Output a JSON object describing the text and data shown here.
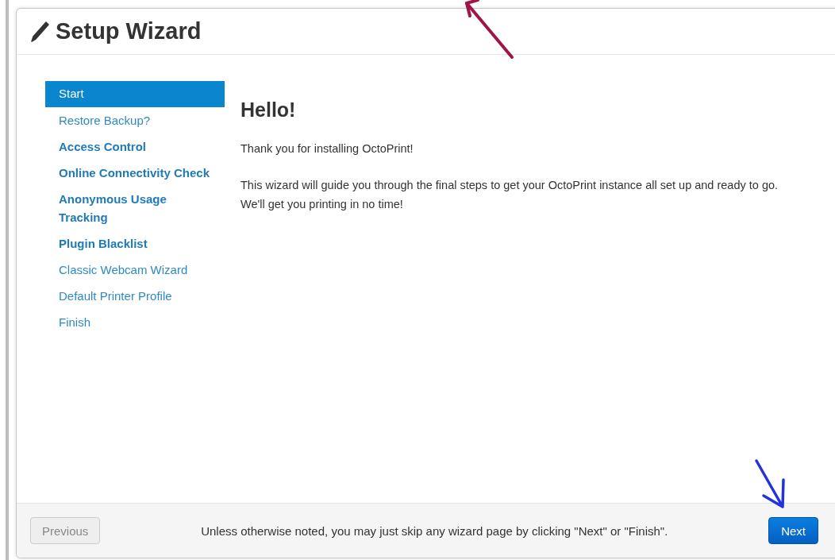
{
  "dialog": {
    "title": "Setup Wizard"
  },
  "steps": [
    {
      "label": "Start",
      "selected": true,
      "kind": "normal"
    },
    {
      "label": "Restore Backup?",
      "selected": false,
      "kind": "normal"
    },
    {
      "label": "Access Control",
      "selected": false,
      "kind": "required"
    },
    {
      "label": "Online Connectivity Check",
      "selected": false,
      "kind": "required"
    },
    {
      "label": "Anonymous Usage Tracking",
      "selected": false,
      "kind": "required"
    },
    {
      "label": "Plugin Blacklist",
      "selected": false,
      "kind": "required"
    },
    {
      "label": "Classic Webcam Wizard",
      "selected": false,
      "kind": "normal"
    },
    {
      "label": "Default Printer Profile",
      "selected": false,
      "kind": "normal"
    },
    {
      "label": "Finish",
      "selected": false,
      "kind": "normal"
    }
  ],
  "content": {
    "heading": "Hello!",
    "paragraphs": [
      "Thank you for installing OctoPrint!",
      "This wizard will guide you through the final steps to get your OctoPrint instance all set up and ready to go. We'll get you printing in no time!"
    ]
  },
  "footer": {
    "previous": {
      "label": "Previous",
      "disabled": true
    },
    "note": "Unless otherwise noted, you may just skip any wizard page by clicking \"Next\" or \"Finish\".",
    "next": {
      "label": "Next",
      "disabled": false
    }
  }
}
